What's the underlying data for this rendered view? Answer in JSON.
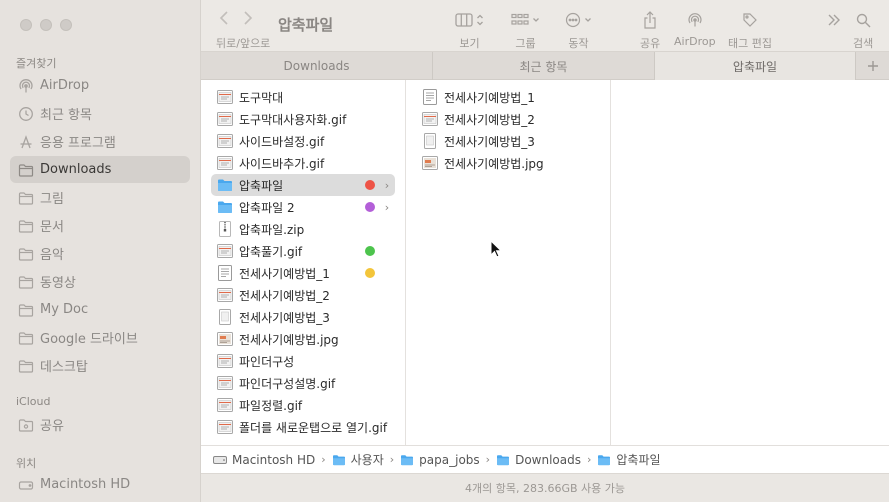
{
  "sidebar": {
    "favorites_header": "즐겨찾기",
    "items": [
      {
        "label": "AirDrop",
        "icon": "airdrop-icon"
      },
      {
        "label": "최근 항목",
        "icon": "clock-icon"
      },
      {
        "label": "응용 프로그램",
        "icon": "apps-icon"
      },
      {
        "label": "Downloads",
        "icon": "folder-icon"
      },
      {
        "label": "그림",
        "icon": "folder-icon"
      },
      {
        "label": "문서",
        "icon": "folder-icon"
      },
      {
        "label": "음악",
        "icon": "folder-icon"
      },
      {
        "label": "동영상",
        "icon": "folder-icon"
      },
      {
        "label": "My Doc",
        "icon": "folder-icon"
      },
      {
        "label": "Google 드라이브",
        "icon": "folder-icon"
      },
      {
        "label": "데스크탑",
        "icon": "folder-icon"
      }
    ],
    "icloud_header": "iCloud",
    "icloud_items": [
      {
        "label": "공유",
        "icon": "shared-folder-icon"
      }
    ],
    "locations_header": "위치",
    "location_items": [
      {
        "label": "Macintosh HD",
        "icon": "disk-icon"
      }
    ]
  },
  "toolbar": {
    "nav_label": "뒤로/앞으로",
    "title": "압축파일",
    "view_label": "보기",
    "group_label": "그룹",
    "action_label": "동작",
    "share_label": "공유",
    "airdrop_label": "AirDrop",
    "tag_label": "태그 편집",
    "search_label": "검색"
  },
  "tabs": [
    {
      "label": "Downloads"
    },
    {
      "label": "최근 항목"
    },
    {
      "label": "압축파일"
    }
  ],
  "column1": [
    {
      "name": "도구막대",
      "icon": "image-file-icon"
    },
    {
      "name": "도구막대사용자화.gif",
      "icon": "image-file-icon"
    },
    {
      "name": "사이드바설정.gif",
      "icon": "image-file-icon"
    },
    {
      "name": "사이드바추가.gif",
      "icon": "image-file-icon"
    },
    {
      "name": "압축파일",
      "icon": "folder-icon",
      "tag": "#ee5346",
      "chevron": "›",
      "selected": true
    },
    {
      "name": "압축파일 2",
      "icon": "folder-icon",
      "tag": "#b35fd8",
      "chevron": "›"
    },
    {
      "name": "압축파일.zip",
      "icon": "zip-file-icon"
    },
    {
      "name": "압축풀기.gif",
      "icon": "image-file-icon",
      "tag": "#4dc44d"
    },
    {
      "name": "전세사기예방법_1",
      "icon": "document-file-icon",
      "tag": "#f3c53a"
    },
    {
      "name": "전세사기예방법_2",
      "icon": "image-file-icon"
    },
    {
      "name": "전세사기예방법_3",
      "icon": "blank-file-icon"
    },
    {
      "name": "전세사기예방법.jpg",
      "icon": "jpg-file-icon"
    },
    {
      "name": "파인더구성",
      "icon": "image-file-icon"
    },
    {
      "name": "파인더구성설명.gif",
      "icon": "image-file-icon"
    },
    {
      "name": "파일정렬.gif",
      "icon": "image-file-icon"
    },
    {
      "name": "폴더를 새로운탭으로 열기.gif",
      "icon": "image-file-icon"
    }
  ],
  "column2": [
    {
      "name": "전세사기예방법_1",
      "icon": "document-file-icon"
    },
    {
      "name": "전세사기예방법_2",
      "icon": "image-file-icon"
    },
    {
      "name": "전세사기예방법_3",
      "icon": "blank-file-icon"
    },
    {
      "name": "전세사기예방법.jpg",
      "icon": "jpg-file-icon"
    }
  ],
  "pathbar": [
    {
      "label": "Macintosh HD",
      "icon": "disk-icon"
    },
    {
      "label": "사용자",
      "icon": "folder-icon"
    },
    {
      "label": "papa_jobs",
      "icon": "folder-icon"
    },
    {
      "label": "Downloads",
      "icon": "folder-icon"
    },
    {
      "label": "압축파일",
      "icon": "folder-icon"
    }
  ],
  "status": "4개의 항목, 283.66GB 사용 가능",
  "colors": {
    "folder": "#4aa8ee",
    "selected_bg": "#dcdcdc",
    "sidebar_bg": "#e6e2de"
  }
}
